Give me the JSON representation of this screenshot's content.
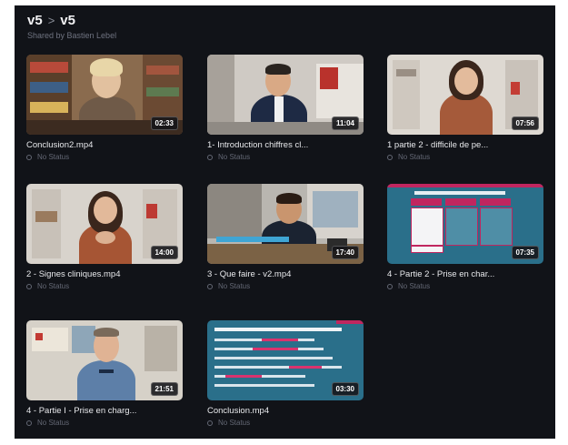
{
  "header": {
    "crumb_parent": "v5",
    "crumb_current": "v5",
    "separator": ">",
    "shared_by": "Shared by Bastien Lebel"
  },
  "videos": [
    {
      "title": "Conclusion2.mp4",
      "duration": "02:33",
      "status": "No Status",
      "thumb": "woman-bookshelf"
    },
    {
      "title": "1- Introduction chiffres cl...",
      "duration": "11:04",
      "status": "No Status",
      "thumb": "man-suit"
    },
    {
      "title": "1 partie 2 - difficile de pe...",
      "duration": "07:56",
      "status": "No Status",
      "thumb": "woman-wall"
    },
    {
      "title": "2 - Signes cliniques.mp4",
      "duration": "14:00",
      "status": "No Status",
      "thumb": "woman-office"
    },
    {
      "title": "3 - Que faire - v2.mp4",
      "duration": "17:40",
      "status": "No Status",
      "thumb": "man-desk"
    },
    {
      "title": "4 - Partie 2 - Prise en char...",
      "duration": "07:35",
      "status": "No Status",
      "thumb": "slide-table"
    },
    {
      "title": "4 - Partie I - Prise en charg...",
      "duration": "21:51",
      "status": "No Status",
      "thumb": "gendarme"
    },
    {
      "title": "Conclusion.mp4",
      "duration": "03:30",
      "status": "No Status",
      "thumb": "slide-text"
    }
  ],
  "colors": {
    "background": "#111318",
    "slide_teal": "#2a6f8a",
    "slide_magenta": "#c0265f"
  }
}
